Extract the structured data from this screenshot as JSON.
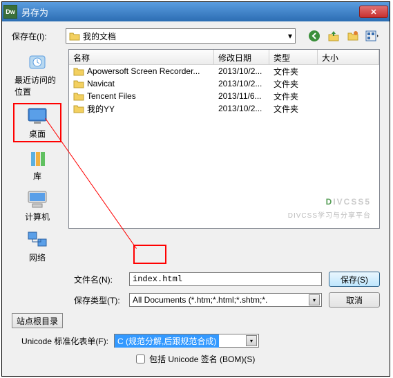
{
  "title": "另存为",
  "app_badge": "Dw",
  "save_in_label": "保存在(I):",
  "save_in_value": "我的文档",
  "columns": {
    "name": "名称",
    "date": "修改日期",
    "type": "类型",
    "size": "大小"
  },
  "sidebar": [
    {
      "label": "最近访问的位置"
    },
    {
      "label": "桌面"
    },
    {
      "label": "库"
    },
    {
      "label": "计算机"
    },
    {
      "label": "网络"
    }
  ],
  "rows": [
    {
      "name": "Apowersoft Screen Recorder...",
      "date": "2013/10/2...",
      "type": "文件夹"
    },
    {
      "name": "Navicat",
      "date": "2013/10/2...",
      "type": "文件夹"
    },
    {
      "name": "Tencent Files",
      "date": "2013/11/6...",
      "type": "文件夹"
    },
    {
      "name": "我的YY",
      "date": "2013/10/2...",
      "type": "文件夹"
    }
  ],
  "watermark": {
    "big1": "D",
    "big2": "IVCSS5",
    "small": "DIVCSS学习与分享平台"
  },
  "filename_label": "文件名(N):",
  "filename_value": "index.html",
  "filetype_label": "保存类型(T):",
  "filetype_value": "All Documents (*.htm;*.html;*.shtm;*. ",
  "save_btn": "保存(S)",
  "cancel_btn": "取消",
  "siteroot_btn": "站点根目录",
  "unicode_label": "Unicode 标准化表单(F):",
  "unicode_value": "C (规范分解,后跟规范合成)",
  "bom_label": "包括 Unicode 签名 (BOM)(S)"
}
